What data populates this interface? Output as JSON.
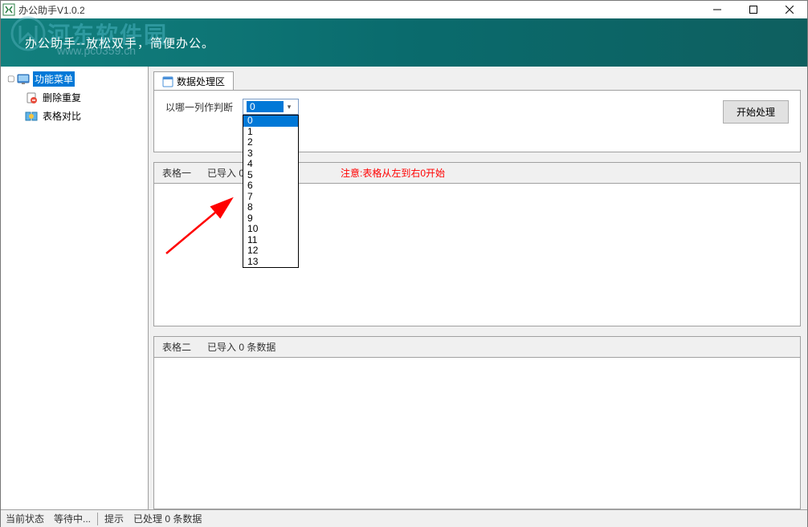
{
  "window": {
    "title": "办公助手V1.0.2"
  },
  "banner": {
    "slogan": "办公助手--放松双手，简便办公。",
    "watermark_text": "河东软件园",
    "watermark_url": "www.pc0359.cn"
  },
  "sidebar": {
    "root": "功能菜单",
    "items": [
      {
        "label": "删除重复"
      },
      {
        "label": "表格对比"
      }
    ]
  },
  "tabs": {
    "main": "数据处理区"
  },
  "judge": {
    "label": "以哪一列作判断",
    "selected": "0",
    "options": [
      "0",
      "1",
      "2",
      "3",
      "4",
      "5",
      "6",
      "7",
      "8",
      "9",
      "10",
      "11",
      "12",
      "13"
    ]
  },
  "buttons": {
    "process": "开始处理"
  },
  "tables": {
    "t1_title": "表格一",
    "t1_info": "已导入 0",
    "t1_hint": "注意:表格从左到右0开始",
    "t2_title": "表格二",
    "t2_info": "已导入 0 条数据"
  },
  "status": {
    "label": "当前状态",
    "value": "等待中...",
    "tip_label": "提示",
    "tip_value": "已处理 0 条数据"
  }
}
